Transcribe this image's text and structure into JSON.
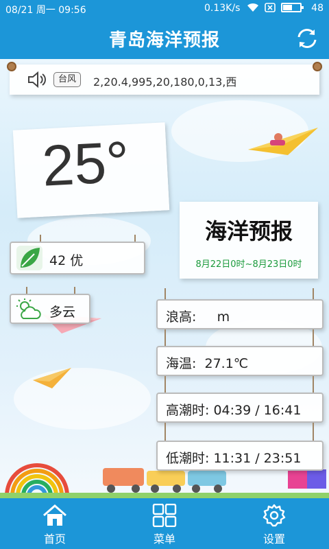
{
  "status_bar": {
    "date": "08/21",
    "weekday": "周一",
    "time": "09:56",
    "network_speed": "0.13K/s",
    "battery": "48"
  },
  "header": {
    "title": "青岛海洋预报",
    "refresh_icon": "refresh-icon"
  },
  "alert": {
    "speaker_icon": "speaker-icon",
    "badge": "台风",
    "text": "2,20.4,995,20,180,0,13,西"
  },
  "current": {
    "temperature": "25°"
  },
  "forecast": {
    "heading": "海洋预报",
    "period": "8月22日0时~8月23日0时"
  },
  "air_quality": {
    "icon": "leaf-icon",
    "label": "42  优"
  },
  "weather": {
    "icon": "partly-cloudy-icon",
    "label": "多云"
  },
  "marine": {
    "wave": "浪高:     m",
    "sea_temp": "海温:  27.1℃",
    "high_tide": "高潮时: 04:39 / 16:41",
    "low_tide": "低潮时: 11:31 / 23:51"
  },
  "tabs": [
    {
      "label": "首页",
      "icon": "home-icon"
    },
    {
      "label": "菜单",
      "icon": "grid-icon"
    },
    {
      "label": "设置",
      "icon": "gear-icon"
    }
  ],
  "colors": {
    "primary": "#1c96d8",
    "forecast_date": "#1a9a3b",
    "leaf": "#3aa645"
  }
}
